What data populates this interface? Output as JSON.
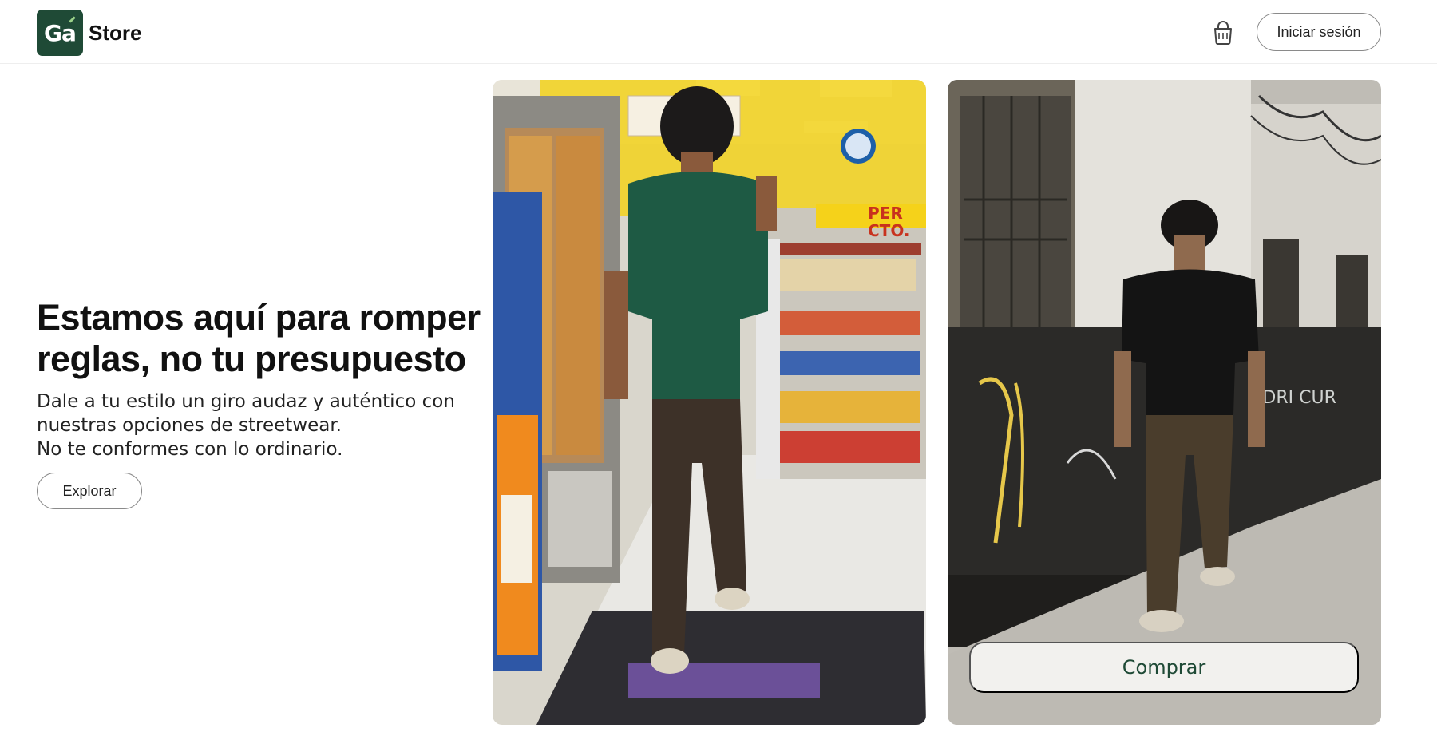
{
  "header": {
    "logo_text": "Ga",
    "brand": "Store",
    "signin_label": "Iniciar sesión",
    "cart_icon": "shopping-bag-icon"
  },
  "hero": {
    "title_line1": "Estamos aquí para romper",
    "title_line2": "reglas, no tu presupuesto",
    "text_line1": "Dale a tu estilo un giro audaz y auténtico con",
    "text_line2": "nuestras opciones de streetwear.",
    "text_line3": "No te conformes con lo ordinario.",
    "explore_label": "Explorar"
  },
  "gallery": {
    "photo1_sign": "PER\nCTO.",
    "photo2_graffiti": "KDRI CUR",
    "buy_label": "Comprar"
  },
  "colors": {
    "brand_green": "#1f4a36",
    "button_border": "#8a8a8a"
  }
}
